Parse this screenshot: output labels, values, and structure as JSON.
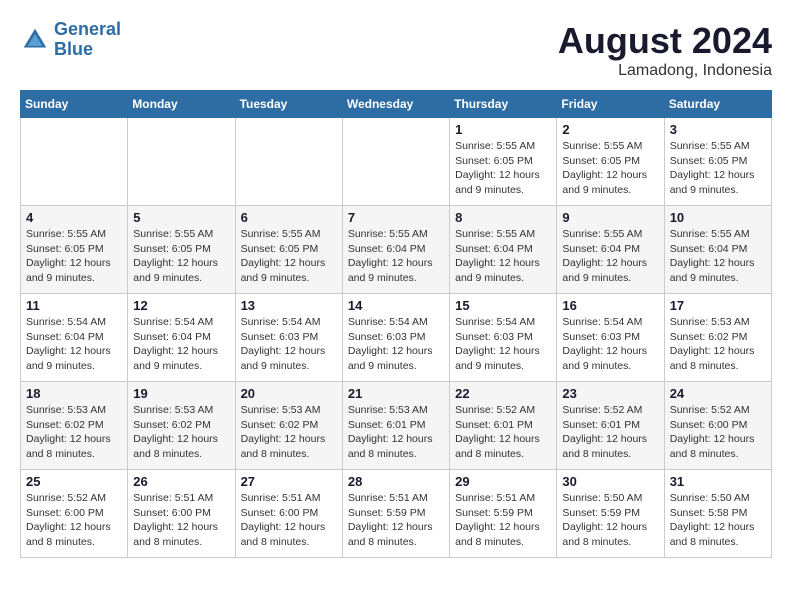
{
  "logo": {
    "line1": "General",
    "line2": "Blue"
  },
  "title": "August 2024",
  "location": "Lamadong, Indonesia",
  "headers": [
    "Sunday",
    "Monday",
    "Tuesday",
    "Wednesday",
    "Thursday",
    "Friday",
    "Saturday"
  ],
  "weeks": [
    [
      {
        "day": "",
        "info": ""
      },
      {
        "day": "",
        "info": ""
      },
      {
        "day": "",
        "info": ""
      },
      {
        "day": "",
        "info": ""
      },
      {
        "day": "1",
        "info": "Sunrise: 5:55 AM\nSunset: 6:05 PM\nDaylight: 12 hours\nand 9 minutes."
      },
      {
        "day": "2",
        "info": "Sunrise: 5:55 AM\nSunset: 6:05 PM\nDaylight: 12 hours\nand 9 minutes."
      },
      {
        "day": "3",
        "info": "Sunrise: 5:55 AM\nSunset: 6:05 PM\nDaylight: 12 hours\nand 9 minutes."
      }
    ],
    [
      {
        "day": "4",
        "info": "Sunrise: 5:55 AM\nSunset: 6:05 PM\nDaylight: 12 hours\nand 9 minutes."
      },
      {
        "day": "5",
        "info": "Sunrise: 5:55 AM\nSunset: 6:05 PM\nDaylight: 12 hours\nand 9 minutes."
      },
      {
        "day": "6",
        "info": "Sunrise: 5:55 AM\nSunset: 6:05 PM\nDaylight: 12 hours\nand 9 minutes."
      },
      {
        "day": "7",
        "info": "Sunrise: 5:55 AM\nSunset: 6:04 PM\nDaylight: 12 hours\nand 9 minutes."
      },
      {
        "day": "8",
        "info": "Sunrise: 5:55 AM\nSunset: 6:04 PM\nDaylight: 12 hours\nand 9 minutes."
      },
      {
        "day": "9",
        "info": "Sunrise: 5:55 AM\nSunset: 6:04 PM\nDaylight: 12 hours\nand 9 minutes."
      },
      {
        "day": "10",
        "info": "Sunrise: 5:55 AM\nSunset: 6:04 PM\nDaylight: 12 hours\nand 9 minutes."
      }
    ],
    [
      {
        "day": "11",
        "info": "Sunrise: 5:54 AM\nSunset: 6:04 PM\nDaylight: 12 hours\nand 9 minutes."
      },
      {
        "day": "12",
        "info": "Sunrise: 5:54 AM\nSunset: 6:04 PM\nDaylight: 12 hours\nand 9 minutes."
      },
      {
        "day": "13",
        "info": "Sunrise: 5:54 AM\nSunset: 6:03 PM\nDaylight: 12 hours\nand 9 minutes."
      },
      {
        "day": "14",
        "info": "Sunrise: 5:54 AM\nSunset: 6:03 PM\nDaylight: 12 hours\nand 9 minutes."
      },
      {
        "day": "15",
        "info": "Sunrise: 5:54 AM\nSunset: 6:03 PM\nDaylight: 12 hours\nand 9 minutes."
      },
      {
        "day": "16",
        "info": "Sunrise: 5:54 AM\nSunset: 6:03 PM\nDaylight: 12 hours\nand 9 minutes."
      },
      {
        "day": "17",
        "info": "Sunrise: 5:53 AM\nSunset: 6:02 PM\nDaylight: 12 hours\nand 8 minutes."
      }
    ],
    [
      {
        "day": "18",
        "info": "Sunrise: 5:53 AM\nSunset: 6:02 PM\nDaylight: 12 hours\nand 8 minutes."
      },
      {
        "day": "19",
        "info": "Sunrise: 5:53 AM\nSunset: 6:02 PM\nDaylight: 12 hours\nand 8 minutes."
      },
      {
        "day": "20",
        "info": "Sunrise: 5:53 AM\nSunset: 6:02 PM\nDaylight: 12 hours\nand 8 minutes."
      },
      {
        "day": "21",
        "info": "Sunrise: 5:53 AM\nSunset: 6:01 PM\nDaylight: 12 hours\nand 8 minutes."
      },
      {
        "day": "22",
        "info": "Sunrise: 5:52 AM\nSunset: 6:01 PM\nDaylight: 12 hours\nand 8 minutes."
      },
      {
        "day": "23",
        "info": "Sunrise: 5:52 AM\nSunset: 6:01 PM\nDaylight: 12 hours\nand 8 minutes."
      },
      {
        "day": "24",
        "info": "Sunrise: 5:52 AM\nSunset: 6:00 PM\nDaylight: 12 hours\nand 8 minutes."
      }
    ],
    [
      {
        "day": "25",
        "info": "Sunrise: 5:52 AM\nSunset: 6:00 PM\nDaylight: 12 hours\nand 8 minutes."
      },
      {
        "day": "26",
        "info": "Sunrise: 5:51 AM\nSunset: 6:00 PM\nDaylight: 12 hours\nand 8 minutes."
      },
      {
        "day": "27",
        "info": "Sunrise: 5:51 AM\nSunset: 6:00 PM\nDaylight: 12 hours\nand 8 minutes."
      },
      {
        "day": "28",
        "info": "Sunrise: 5:51 AM\nSunset: 5:59 PM\nDaylight: 12 hours\nand 8 minutes."
      },
      {
        "day": "29",
        "info": "Sunrise: 5:51 AM\nSunset: 5:59 PM\nDaylight: 12 hours\nand 8 minutes."
      },
      {
        "day": "30",
        "info": "Sunrise: 5:50 AM\nSunset: 5:59 PM\nDaylight: 12 hours\nand 8 minutes."
      },
      {
        "day": "31",
        "info": "Sunrise: 5:50 AM\nSunset: 5:58 PM\nDaylight: 12 hours\nand 8 minutes."
      }
    ]
  ]
}
